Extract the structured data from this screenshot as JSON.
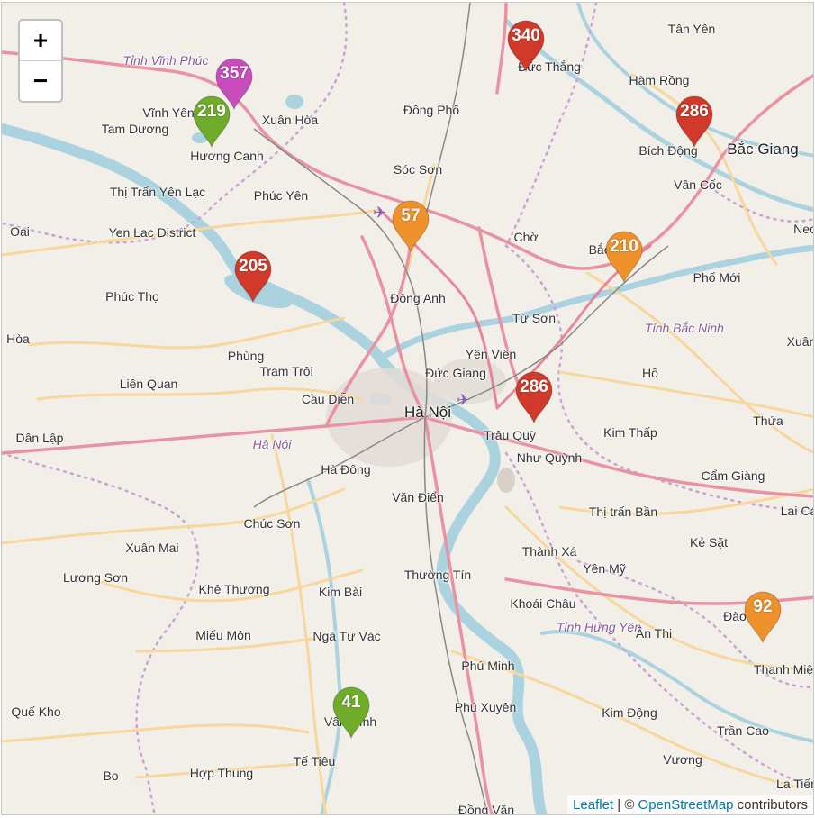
{
  "zoom": {
    "in_label": "+",
    "out_label": "−"
  },
  "attribution": {
    "leaflet": "Leaflet",
    "sep": " | © ",
    "osm": "OpenStreetMap",
    "suffix": " contributors"
  },
  "places": [
    {
      "name": "Tân Yên",
      "type": "town"
    },
    {
      "name": "Đức Thắng",
      "type": "town"
    },
    {
      "name": "Hàm Rồng",
      "type": "town"
    },
    {
      "name": "Tỉnh Vĩnh Phúc",
      "type": "region"
    },
    {
      "name": "Vĩnh Yên",
      "type": "town"
    },
    {
      "name": "Tam Dương",
      "type": "town"
    },
    {
      "name": "Xuân Hòa",
      "type": "town"
    },
    {
      "name": "Đồng Phố",
      "type": "town"
    },
    {
      "name": "Bích Động",
      "type": "town"
    },
    {
      "name": "Bắc Giang",
      "type": "major"
    },
    {
      "name": "Hương Canh",
      "type": "town"
    },
    {
      "name": "Sóc Sơn",
      "type": "town"
    },
    {
      "name": "Vân Cốc",
      "type": "town"
    },
    {
      "name": "Thị Trấn Yên Lạc",
      "type": "town"
    },
    {
      "name": "Phúc Yên",
      "type": "town"
    },
    {
      "name": "Yen Lac District",
      "type": "town"
    },
    {
      "name": "Chờ",
      "type": "town"
    },
    {
      "name": "Bắc Ninh",
      "type": "town"
    },
    {
      "name": "Phố Mới",
      "type": "town"
    },
    {
      "name": "Phúc Thọ",
      "type": "town"
    },
    {
      "name": "Đông Anh",
      "type": "town"
    },
    {
      "name": "Từ Sơn",
      "type": "town"
    },
    {
      "name": "Tỉnh Bắc Ninh",
      "type": "region"
    },
    {
      "name": "Phùng",
      "type": "town"
    },
    {
      "name": "Yên Viên",
      "type": "town"
    },
    {
      "name": "Trạm Trôi",
      "type": "town"
    },
    {
      "name": "Đức Giang",
      "type": "town"
    },
    {
      "name": "Hồ",
      "type": "town"
    },
    {
      "name": "Liên Quan",
      "type": "town"
    },
    {
      "name": "Cầu Diễn",
      "type": "town"
    },
    {
      "name": "Hà Nội",
      "type": "major"
    },
    {
      "name": "Trâu Quỳ",
      "type": "town"
    },
    {
      "name": "Kim Thấp",
      "type": "town"
    },
    {
      "name": "Thứa",
      "type": "town"
    },
    {
      "name": "Dân Lập",
      "type": "town"
    },
    {
      "name": "Hà Nội",
      "type": "region"
    },
    {
      "name": "Như Quỳnh",
      "type": "town"
    },
    {
      "name": "Hà Đông",
      "type": "town"
    },
    {
      "name": "Cẩm Giàng",
      "type": "town"
    },
    {
      "name": "Văn Điển",
      "type": "town"
    },
    {
      "name": "Thị trấn Bần",
      "type": "town"
    },
    {
      "name": "Chúc Sơn",
      "type": "town"
    },
    {
      "name": "Lai Cá",
      "type": "town"
    },
    {
      "name": "Xuân Mai",
      "type": "town"
    },
    {
      "name": "Thành Xá",
      "type": "town"
    },
    {
      "name": "Kẻ Sặt",
      "type": "town"
    },
    {
      "name": "Lương Sơn",
      "type": "town"
    },
    {
      "name": "Yên Mỹ",
      "type": "town"
    },
    {
      "name": "Thường Tín",
      "type": "town"
    },
    {
      "name": "Khê Thượng",
      "type": "town"
    },
    {
      "name": "Kim Bài",
      "type": "town"
    },
    {
      "name": "Khoái Châu",
      "type": "town"
    },
    {
      "name": "Tỉnh Hưng Yên",
      "type": "region"
    },
    {
      "name": "Ân Thi",
      "type": "town"
    },
    {
      "name": "Miếu Môn",
      "type": "town"
    },
    {
      "name": "Ngã Tư Vác",
      "type": "town"
    },
    {
      "name": "Thanh Miện",
      "type": "town"
    },
    {
      "name": "Phú Minh",
      "type": "town"
    },
    {
      "name": "Vân Đình",
      "type": "town"
    },
    {
      "name": "Phú Xuyên",
      "type": "town"
    },
    {
      "name": "Kim Động",
      "type": "town"
    },
    {
      "name": "Quế Kho",
      "type": "town"
    },
    {
      "name": "Trần Cao",
      "type": "town"
    },
    {
      "name": "Tế Tiêu",
      "type": "town"
    },
    {
      "name": "Vương",
      "type": "town"
    },
    {
      "name": "Bo",
      "type": "town"
    },
    {
      "name": "Hợp Thung",
      "type": "town"
    },
    {
      "name": "La Tiến",
      "type": "town"
    },
    {
      "name": "Đồng Văn",
      "type": "town"
    },
    {
      "name": "Oai",
      "type": "town"
    },
    {
      "name": "Hòa",
      "type": "town"
    },
    {
      "name": "Xuân",
      "type": "town"
    },
    {
      "name": "Neo",
      "type": "town"
    },
    {
      "name": "Đào",
      "type": "town"
    }
  ],
  "markers": [
    {
      "value": "340",
      "color": "#d13a2b"
    },
    {
      "value": "357",
      "color": "#c94dbd"
    },
    {
      "value": "219",
      "color": "#6fac2a"
    },
    {
      "value": "286",
      "color": "#d13a2b"
    },
    {
      "value": "57",
      "color": "#f0922b"
    },
    {
      "value": "205",
      "color": "#d13a2b"
    },
    {
      "value": "210",
      "color": "#f0922b"
    },
    {
      "value": "286",
      "color": "#d13a2b"
    },
    {
      "value": "92",
      "color": "#f0922b"
    },
    {
      "value": "41",
      "color": "#6fac2a"
    }
  ]
}
